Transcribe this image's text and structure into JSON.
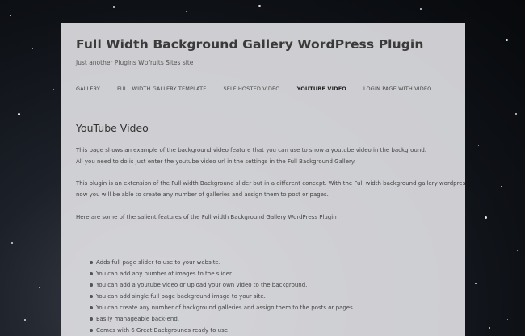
{
  "site": {
    "title": "Full Width Background Gallery WordPress Plugin",
    "description": "Just another Plugins Wpfruits Sites site"
  },
  "nav": {
    "items": [
      {
        "label": "GALLERY",
        "active": false
      },
      {
        "label": "FULL WIDTH GALLERY TEMPLATE",
        "active": false
      },
      {
        "label": "SELF HOSTED VIDEO",
        "active": false
      },
      {
        "label": "YOUTUBE VIDEO",
        "active": true
      },
      {
        "label": "LOGIN PAGE WITH VIDEO",
        "active": false
      }
    ]
  },
  "content": {
    "title": "YouTube Video",
    "paragraphs": [
      {
        "line1": "This page shows an example of the background video feature that you can use to show a youtube video in the background.",
        "line2": "All you need to do is just enter the youtube video url in the settings in the Full Background Gallery."
      },
      {
        "line1": "This plugin is an extension of the Full width Background slider but in a different concept. With the Full width background gallery wordpress plugin",
        "line2": "now you will be able to create any number of galleries and assign them to post or pages."
      },
      {
        "line1": "Here are some of the salient features of the Full width Background Gallery WordPress Plugin"
      }
    ],
    "features": [
      "Adds full page slider to use to your website.",
      "You can add any number of images to the slider",
      "You can add a youtube video or upload your own video to the background.",
      "You can add single full page background image to your site.",
      "You can create any number of background galleries and assign them to the posts or pages.",
      "Easily manageable back-end.",
      "Comes with 6 Great Backgrounds ready to use"
    ]
  }
}
